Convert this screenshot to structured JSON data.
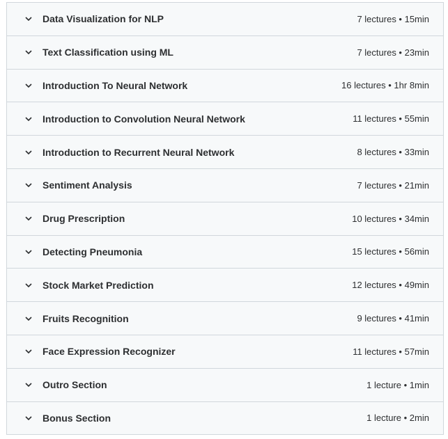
{
  "sections": [
    {
      "title": "Data Visualization for NLP",
      "meta": "7 lectures • 15min"
    },
    {
      "title": "Text Classification using ML",
      "meta": "7 lectures • 23min"
    },
    {
      "title": "Introduction To Neural Network",
      "meta": "16 lectures • 1hr 8min"
    },
    {
      "title": "Introduction to Convolution Neural Network",
      "meta": "11 lectures • 55min"
    },
    {
      "title": "Introduction to Recurrent Neural Network",
      "meta": "8 lectures • 33min"
    },
    {
      "title": "Sentiment Analysis",
      "meta": "7 lectures • 21min"
    },
    {
      "title": "Drug Prescription",
      "meta": "10 lectures • 34min"
    },
    {
      "title": "Detecting Pneumonia",
      "meta": "15 lectures • 56min"
    },
    {
      "title": "Stock Market Prediction",
      "meta": "12 lectures • 49min"
    },
    {
      "title": "Fruits Recognition",
      "meta": "9 lectures • 41min"
    },
    {
      "title": "Face Expression Recognizer",
      "meta": "11 lectures • 57min"
    },
    {
      "title": "Outro Section",
      "meta": "1 lecture • 1min"
    },
    {
      "title": "Bonus Section",
      "meta": "1 lecture • 2min"
    }
  ],
  "icon": "chevron-down-icon"
}
